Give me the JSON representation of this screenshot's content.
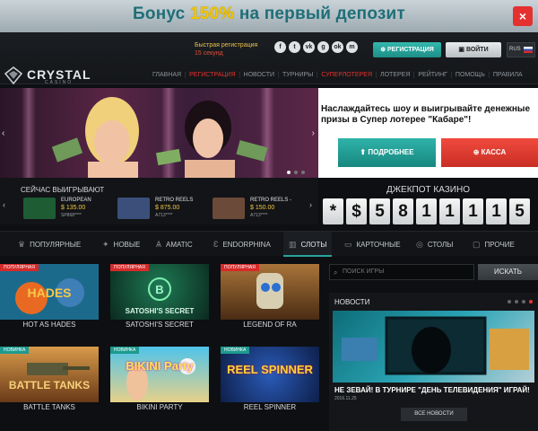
{
  "promo": {
    "text_before": "Бонус ",
    "text_pct": "150%",
    "text_after": " на первый депозит",
    "close": "×"
  },
  "header": {
    "fast_reg_line1": "Быстрая регистрация",
    "fast_reg_line2": "15 секунд",
    "register": "РЕГИСТРАЦИЯ",
    "login": "ВОЙТИ",
    "language": "RUS",
    "socials": [
      "f",
      "t",
      "vk",
      "g",
      "ok",
      "m"
    ]
  },
  "logo": {
    "name": "CRYSTAL",
    "sub": "CASINO"
  },
  "nav": [
    "ГЛАВНАЯ",
    "РЕГИСТРАЦИЯ",
    "НОВОСТИ",
    "ТУРНИРЫ",
    "СУПЕРЛОТЕРЕЯ",
    "ЛОТЕРЕЯ",
    "РЕЙТИНГ",
    "ПОМОЩЬ",
    "ПРАВИЛА"
  ],
  "hero": {
    "description": "Наслаждайтесь шоу и выигрывайте денежные призы в Супер лотерее \"Кабаре\"!",
    "more": "ПОДРОБНЕЕ",
    "cash": "КАССА"
  },
  "winners": {
    "title": "СЕЙЧАС ВЫИГРЫВАЮТ",
    "items": [
      {
        "name": "EUROPEAN",
        "amount": "$ 135.00",
        "user": "SP868****",
        "color": "#1e5c34"
      },
      {
        "name": "RETRO REELS",
        "amount": "$ 875.00",
        "user": "A713****",
        "color": "#3b4f7a"
      },
      {
        "name": "RETRO REELS -",
        "amount": "$ 150.00",
        "user": "A713****",
        "color": "#6b4a3a"
      }
    ]
  },
  "jackpot": {
    "title": "ДЖЕКПОТ КАЗИНО",
    "digits": [
      "*",
      "$",
      "5",
      "8",
      "1",
      "1",
      "1",
      "1",
      "5"
    ]
  },
  "categories": [
    {
      "label": "ПОПУЛЯРНЫЕ",
      "icon": "♛"
    },
    {
      "label": "НОВЫЕ",
      "icon": "✦"
    },
    {
      "label": "AMATIC",
      "icon": "Ѧ"
    },
    {
      "label": "ENDORPHINA",
      "icon": "Ɛ"
    },
    {
      "label": "СЛОТЫ",
      "icon": "▥"
    },
    {
      "label": "КАРТОЧНЫЕ",
      "icon": "▭"
    },
    {
      "label": "СТОЛЫ",
      "icon": "◎"
    },
    {
      "label": "ПРОЧИЕ",
      "icon": "▢"
    }
  ],
  "search": {
    "placeholder": "ПОИСК ИГРЫ",
    "button": "ИСКАТЬ"
  },
  "games": [
    {
      "title": "HOT AS HADES",
      "badge": "ПОПУЛЯРНАЯ",
      "badge_type": "popular",
      "art": "HADES",
      "bg": "#1b6a8c",
      "fg": "#f6c94a"
    },
    {
      "title": "SATOSHI'S SECRET",
      "badge": "ПОПУЛЯРНАЯ",
      "badge_type": "popular",
      "art": "SATOSHI'S SECRET",
      "bg": "#0f3a2c",
      "fg": "#d8f5e6"
    },
    {
      "title": "LEGEND OF RA",
      "badge": "ПОПУЛЯРНАЯ",
      "badge_type": "popular",
      "art": "",
      "bg": "#5c3a1d",
      "fg": "#f2d37a"
    },
    {
      "title": "BATTLE TANKS",
      "badge": "НОВИНКА",
      "badge_type": "new",
      "art": "BATTLE TANKS",
      "bg": "#8a5626",
      "fg": "#f5d27a"
    },
    {
      "title": "BIKINI PARTY",
      "badge": "НОВИНКА",
      "badge_type": "new",
      "art": "BIKINI Party",
      "bg": "#3bb0d8",
      "fg": "#ffe35a"
    },
    {
      "title": "REEL SPINNER",
      "badge": "НОВИНКА",
      "badge_type": "new",
      "art": "REEL SPINNER",
      "bg": "#173a7a",
      "fg": "#ffd23a"
    }
  ],
  "news": {
    "heading": "НОВОСТИ",
    "title": "НЕ ЗЕВАЙ! В ТУРНИРЕ \"ДЕНЬ ТЕЛЕВИДЕНИЯ\" ИГРАЙ!",
    "date": "2016.11.25",
    "all": "ВСЕ НОВОСТИ"
  },
  "colors": {
    "accent": "#28a49b",
    "danger": "#e0332f",
    "gold": "#f2c500"
  }
}
